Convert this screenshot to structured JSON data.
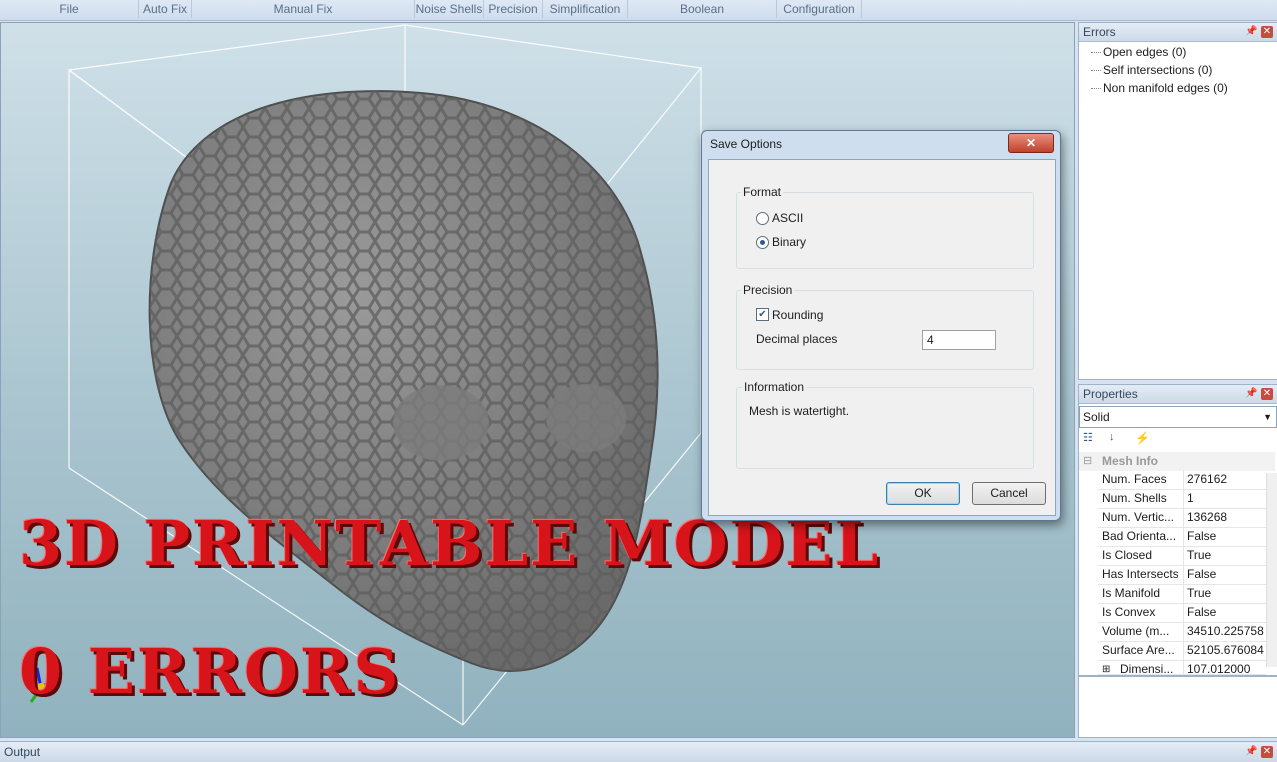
{
  "ribbon": {
    "groups": [
      "File",
      "Auto Fix",
      "Manual Fix",
      "Noise Shells",
      "Precision",
      "Simplification",
      "Boolean",
      "Configuration"
    ]
  },
  "overlay": {
    "line1": "3D PRINTABLE MODEL",
    "line2": "0 ERRORS"
  },
  "errors_pane": {
    "title": "Errors",
    "items": [
      "Open edges (0)",
      "Self intersections (0)",
      "Non manifold edges (0)"
    ]
  },
  "properties_pane": {
    "title": "Properties",
    "selector_value": "Solid",
    "category": "Mesh Info",
    "rows": [
      {
        "name": "Num. Faces",
        "value": "276162"
      },
      {
        "name": "Num. Shells",
        "value": "1"
      },
      {
        "name": "Num. Vertic...",
        "value": "136268"
      },
      {
        "name": "Bad Orienta...",
        "value": "False"
      },
      {
        "name": "Is Closed",
        "value": "True"
      },
      {
        "name": "Has Intersects",
        "value": "False"
      },
      {
        "name": "Is Manifold",
        "value": "True"
      },
      {
        "name": "Is Convex",
        "value": "False"
      },
      {
        "name": "Volume (m...",
        "value": "34510.225758"
      },
      {
        "name": "Surface Are...",
        "value": "52105.676084"
      },
      {
        "name": "Dimensi...",
        "value": "107.012000"
      }
    ]
  },
  "dialog": {
    "title": "Save Options",
    "format_label": "Format",
    "options": [
      "ASCII",
      "Binary"
    ],
    "selected_option": "Binary",
    "precision_label": "Precision",
    "rounding_label": "Rounding",
    "rounding_checked": true,
    "decimal_label": "Decimal places",
    "decimal_value": "4",
    "info_label": "Information",
    "info_text": "Mesh is watertight.",
    "ok_label": "OK",
    "cancel_label": "Cancel"
  },
  "output_bar": {
    "title": "Output"
  },
  "colors": {
    "overlay_text": "#d7141a",
    "accent": "#2d5a8c"
  }
}
